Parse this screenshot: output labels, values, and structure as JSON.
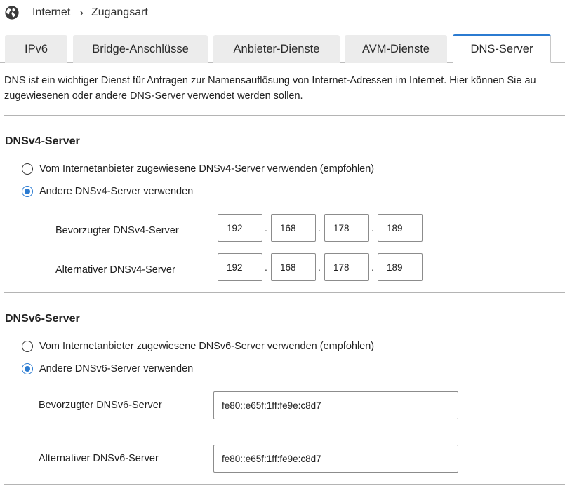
{
  "breadcrumb": {
    "icon": "globe-icon",
    "items": [
      "Internet",
      "Zugangsart"
    ],
    "separator": "›"
  },
  "tabs": [
    {
      "label": "IPv6",
      "active": false
    },
    {
      "label": "Bridge-Anschlüsse",
      "active": false
    },
    {
      "label": "Anbieter-Dienste",
      "active": false
    },
    {
      "label": "AVM-Dienste",
      "active": false
    },
    {
      "label": "DNS-Server",
      "active": true
    }
  ],
  "intro": {
    "line1": "DNS ist ein wichtiger Dienst für Anfragen zur Namensauflösung von Internet-Adressen im Internet. Hier können Sie au",
    "line2": "zugewiesenen oder andere DNS-Server verwendet werden sollen."
  },
  "dnsv4": {
    "title": "DNSv4-Server",
    "option_provider": "Vom Internetanbieter zugewiesene DNSv4-Server verwenden (empfohlen)",
    "option_other": "Andere DNSv4-Server verwenden",
    "selected": "other",
    "preferred_label": "Bevorzugter DNSv4-Server",
    "preferred": [
      "192",
      "168",
      "178",
      "189"
    ],
    "alternative_label": "Alternativer DNSv4-Server",
    "alternative": [
      "192",
      "168",
      "178",
      "189"
    ],
    "octet_separator": "."
  },
  "dnsv6": {
    "title": "DNSv6-Server",
    "option_provider": "Vom Internetanbieter zugewiesene DNSv6-Server verwenden (empfohlen)",
    "option_other": "Andere DNSv6-Server verwenden",
    "selected": "other",
    "preferred_label": "Bevorzugter DNSv6-Server",
    "preferred": "fe80::e65f:1ff:fe9e:c8d7",
    "alternative_label": "Alternativer DNSv6-Server",
    "alternative": "fe80::e65f:1ff:fe9e:c8d7"
  },
  "colors": {
    "accent": "#2b7bd1",
    "tab_inactive": "#ececec",
    "divider": "#b4b4b4"
  }
}
